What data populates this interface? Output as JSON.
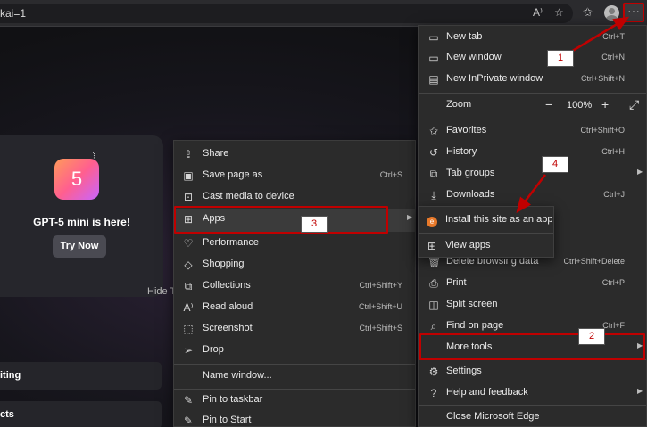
{
  "browser": {
    "url": "kai=1",
    "icons": {
      "read_aloud": "read-aloud-icon",
      "favorite_star": "star-icon",
      "favorites_bar": "favorites-icon",
      "profile": "profile-avatar",
      "more": "more-icon"
    }
  },
  "page": {
    "promo_logo_text": "5",
    "promo_title": "GPT-5 mini is here!",
    "promo_button": "Try Now",
    "hide_text": "Hide T",
    "tile1": "iting",
    "tile2": "cts"
  },
  "main_menu": {
    "items": [
      {
        "label": "New tab",
        "shortcut": "Ctrl+T",
        "icon": "new-tab-icon"
      },
      {
        "label": "New window",
        "shortcut": "Ctrl+N",
        "icon": "new-window-icon"
      },
      {
        "label": "New InPrivate window",
        "shortcut": "Ctrl+Shift+N",
        "icon": "inprivate-icon"
      },
      {
        "label": "Zoom",
        "zoom_value": "100%",
        "icon": "zoom"
      },
      {
        "label": "Favorites",
        "shortcut": "Ctrl+Shift+O",
        "icon": "favorites-icon"
      },
      {
        "label": "History",
        "shortcut": "Ctrl+H",
        "icon": "history-icon"
      },
      {
        "label": "Tab groups",
        "shortcut": "",
        "icon": "tab-groups-icon"
      },
      {
        "label": "Downloads",
        "shortcut": "Ctrl+J",
        "icon": "download-icon"
      },
      {
        "label": "Delete browsing data",
        "shortcut": "Ctrl+Shift+Delete",
        "icon": "delete-icon"
      },
      {
        "label": "Print",
        "shortcut": "Ctrl+P",
        "icon": "print-icon"
      },
      {
        "label": "Split screen",
        "shortcut": "",
        "icon": "split-screen-icon"
      },
      {
        "label": "Find on page",
        "shortcut": "Ctrl+F",
        "icon": "find-icon"
      },
      {
        "label": "More tools",
        "shortcut": "",
        "icon": ""
      },
      {
        "label": "Settings",
        "shortcut": "",
        "icon": "gear-icon"
      },
      {
        "label": "Help and feedback",
        "shortcut": "",
        "icon": "help-icon"
      },
      {
        "label": "Close Microsoft Edge",
        "shortcut": "",
        "icon": ""
      }
    ]
  },
  "apps_flyout": {
    "items": [
      {
        "label": "Install this site as an app",
        "icon": "edge-app-icon"
      },
      {
        "label": "View apps",
        "icon": "apps-grid-icon"
      }
    ]
  },
  "more_tools_menu": {
    "items": [
      {
        "label": "Share",
        "shortcut": "",
        "icon": "share-icon"
      },
      {
        "label": "Save page as",
        "shortcut": "Ctrl+S",
        "icon": "save-icon"
      },
      {
        "label": "Cast media to device",
        "shortcut": "",
        "icon": "cast-icon"
      },
      {
        "label": "Apps",
        "shortcut": "",
        "icon": "apps-grid-icon"
      },
      {
        "label": "Performance",
        "shortcut": "",
        "icon": "performance-icon"
      },
      {
        "label": "Shopping",
        "shortcut": "",
        "icon": "shopping-tag-icon"
      },
      {
        "label": "Collections",
        "shortcut": "Ctrl+Shift+Y",
        "icon": "collections-icon"
      },
      {
        "label": "Read aloud",
        "shortcut": "Ctrl+Shift+U",
        "icon": "read-aloud-icon"
      },
      {
        "label": "Screenshot",
        "shortcut": "Ctrl+Shift+S",
        "icon": "screenshot-icon"
      },
      {
        "label": "Drop",
        "shortcut": "",
        "icon": "drop-icon"
      },
      {
        "label": "Name window...",
        "shortcut": "",
        "icon": ""
      },
      {
        "label": "Pin to taskbar",
        "shortcut": "",
        "icon": "pin-icon"
      },
      {
        "label": "Pin to Start",
        "shortcut": "",
        "icon": "pin-icon"
      }
    ]
  },
  "callouts": [
    "1",
    "2",
    "3",
    "4"
  ],
  "colors": {
    "annotation_red": "#c00000",
    "menu_bg": "#2b2b2b",
    "accent_orange": "#e8792a"
  }
}
